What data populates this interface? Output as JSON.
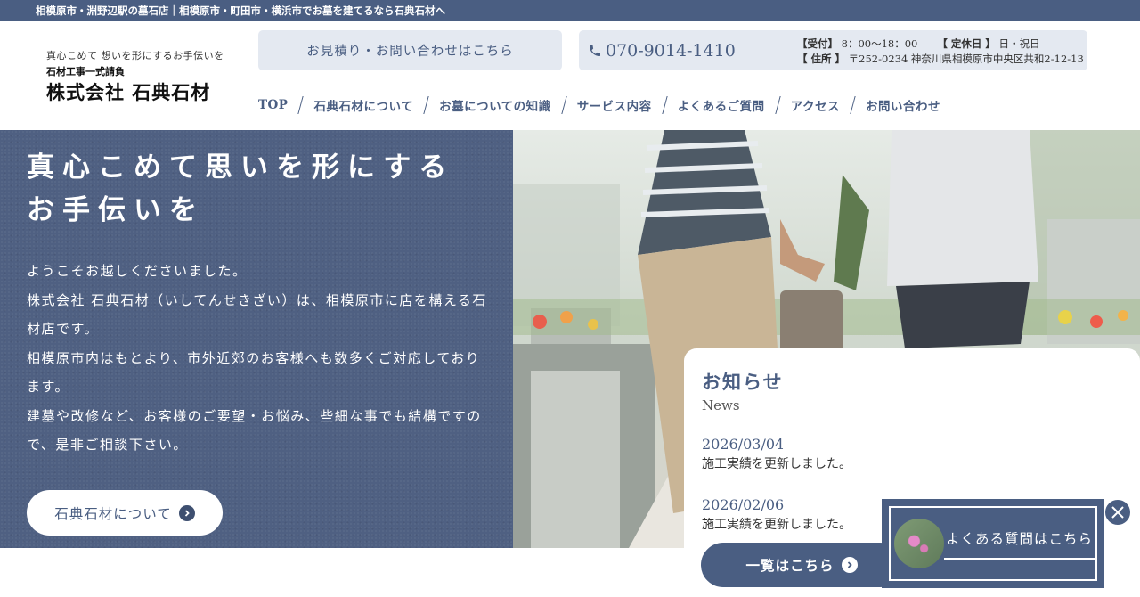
{
  "topbar": {
    "text": "相模原市・淵野辺駅の墓石店｜相模原市・町田市・横浜市でお墓を建てるなら石典石材へ"
  },
  "logo": {
    "tagline": "真心こめて 想いを形にするお手伝いを",
    "sub": "石材工事一式請負",
    "name": "株式会社 石典石材"
  },
  "header": {
    "contact_label": "お見積り・お問い合わせはこちら",
    "phone": "070-9014-1410",
    "hours_label": "【受付】",
    "hours_value": "8：00〜18：00",
    "holiday_label": "【 定休日 】",
    "holiday_value": "日・祝日",
    "address_label": "【 住所 】",
    "address_value": "〒252-0234 神奈川県相模原市中央区共和2-12-13"
  },
  "nav": {
    "items": [
      {
        "label": "TOP"
      },
      {
        "label": "石典石材について"
      },
      {
        "label": "お墓についての知識"
      },
      {
        "label": "サービス内容"
      },
      {
        "label": "よくあるご質問"
      },
      {
        "label": "アクセス"
      },
      {
        "label": "お問い合わせ"
      }
    ]
  },
  "hero": {
    "title_line1": "真心こめて思いを形にする",
    "title_line2": "お手伝いを",
    "paragraphs": [
      "ようこそお越しくださいました。",
      "株式会社 石典石材（いしてんせきざい）は、相模原市に店を構える石材店です。",
      "相模原市内はもとより、市外近郊のお客様へも数多くご対応しております。",
      "建墓や改修など、お客様のご要望・お悩み、些細な事でも結構ですので、是非ご相談下さい。"
    ],
    "button_label": "石典石材について"
  },
  "news": {
    "title": "お知らせ",
    "subtitle": "News",
    "items": [
      {
        "date": "2026/03/04",
        "text": "施工実績を更新しました。"
      },
      {
        "date": "2026/02/06",
        "text": "施工実績を更新しました。"
      }
    ],
    "button_label": "一覧はこちら"
  },
  "faq_banner": {
    "label": "よくある質問はこちら"
  },
  "colors": {
    "primary": "#4a5e82",
    "light": "#e4e9f1"
  },
  "icons": {
    "phone": "phone-icon",
    "arrow": "chevron-right-circle-icon",
    "close": "close-icon"
  }
}
